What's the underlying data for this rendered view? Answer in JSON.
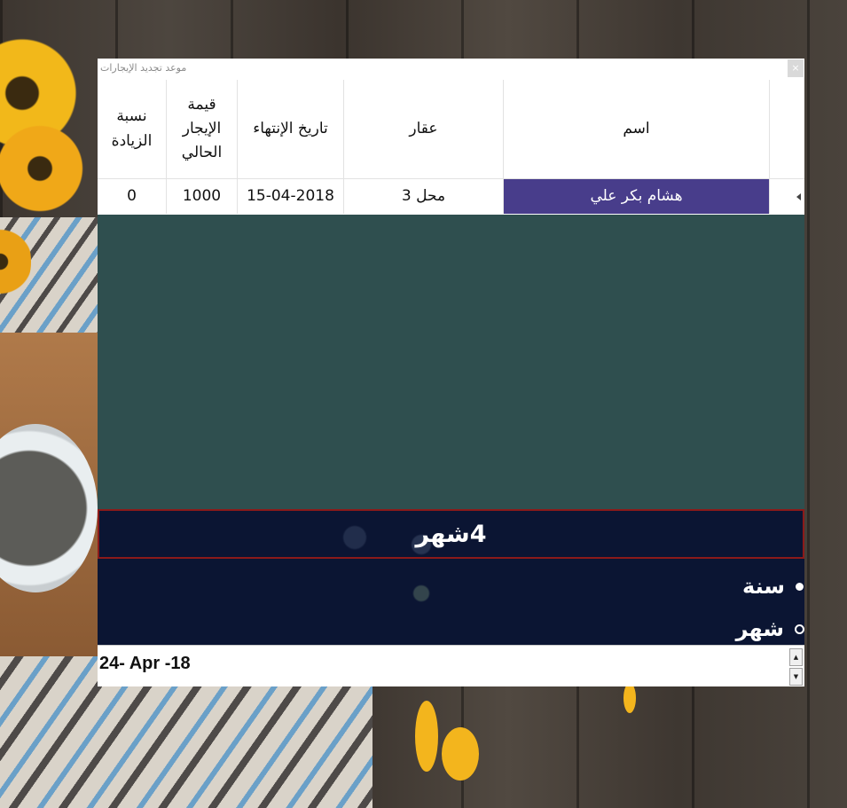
{
  "window": {
    "title": "موعد تجديد الإيجارات",
    "close_label": "×"
  },
  "grid": {
    "columns": [
      "نسبة الزيادة",
      "قيمة الإيجار الحالي",
      "تاريخ الإنتهاء",
      "عقار",
      "اسم"
    ],
    "rows": [
      {
        "increase_rate": "0",
        "current_rent": "1000",
        "end_date": "15-04-2018",
        "property": "محل 3",
        "name": "هشام بكر علي"
      }
    ]
  },
  "period": {
    "value": "4",
    "unit": "شهر"
  },
  "options": [
    {
      "label": "سنة",
      "checked": true
    },
    {
      "label": "شهر",
      "checked": false
    }
  ],
  "date_picker": {
    "value": "24- Apr -18"
  },
  "colors": {
    "selected_row": "#483d8b",
    "empty_grid": "#2f4f4f",
    "panel_bg": "#0b1533",
    "period_border": "#8b1a1a"
  }
}
